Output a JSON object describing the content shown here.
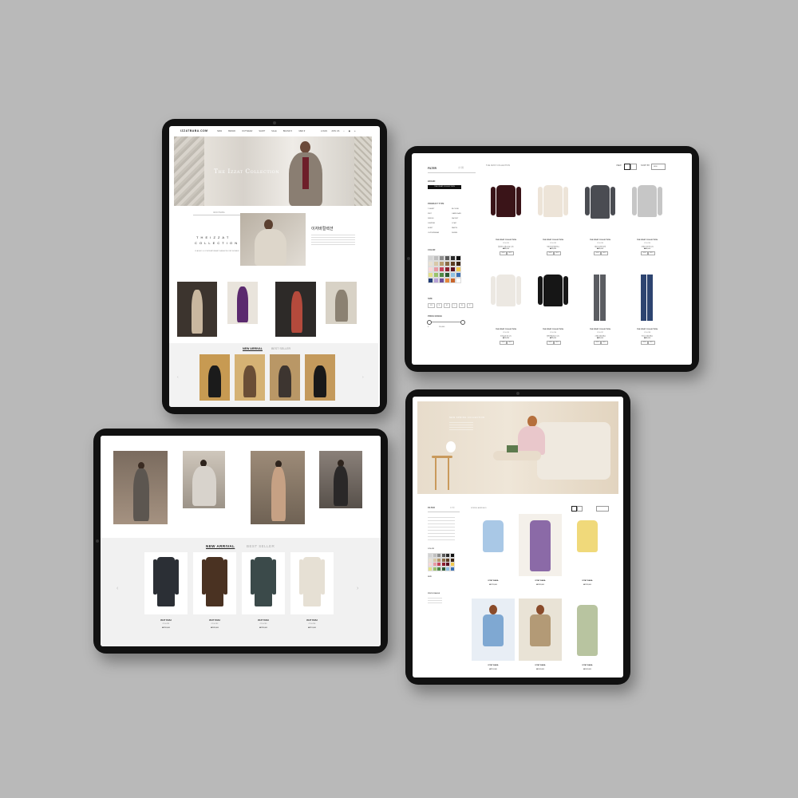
{
  "tablet1": {
    "logo": "IZZATBABA.COM",
    "nav": [
      "NEW",
      "BRAND",
      "OUTWEAR",
      "SHIRT",
      "SALE",
      "BRAND▼",
      "MEN▼"
    ],
    "util": [
      "LOGIN",
      "JOIN US"
    ],
    "hero_title": "The Izzat Collection",
    "section_label": "IZZAT BABA",
    "collection_title": "T H E   I Z Z A T",
    "collection_sub": "C O L L E C T I O N",
    "collection_desc": "CLASSIC & CONTEMPORARY FASHION FOR WOMEN",
    "korean_title": "이자바컬렉션",
    "tab_new": "NEW ARRIVAL",
    "tab_best": "BEST SELLER"
  },
  "tablet2": {
    "filter_label": "FILTER",
    "reset_label": "초기화",
    "breadcrumb": "THE IZZAT COLLECTION",
    "brand_label": "BRAND",
    "brand_selected": "THE IZZAT COLLECTION",
    "product_type_label": "PRODUCT TYPE",
    "product_types": [
      "T-SHIRT",
      "BLOUSE",
      "KNIT",
      "CARDIGAN",
      "DRESS",
      "JACKET",
      "JUMPER",
      "COAT",
      "SKIRT",
      "PANTS",
      "OUTERWEAR",
      "DENIM"
    ],
    "color_label": "COLOR",
    "size_label": "SIZE",
    "sizes": [
      "XS",
      "S",
      "M",
      "L",
      "XL",
      "F"
    ],
    "price_label": "PRICE RANGE",
    "price_min": "0",
    "price_max": "200,000",
    "view_label": "VIEW",
    "sort_label": "SORT BY",
    "sort_value": "NEW",
    "products": [
      {
        "brand": "THE IZZAT COLLECTION",
        "code": "C13-C81",
        "name": "블라우스 에스트로 니트",
        "price": "₩89,000"
      },
      {
        "brand": "THE IZZAT COLLECTION",
        "code": "C13-C82",
        "name": "크림 타이 블라우스",
        "price": "₩79,000"
      },
      {
        "brand": "THE IZZAT COLLECTION",
        "code": "C13-C83",
        "name": "데님 트러커 자켓",
        "price": "₩99,000"
      },
      {
        "brand": "THE IZZAT COLLECTION",
        "code": "C13-C84",
        "name": "그레이 크루넥 니트",
        "price": "₩69,000"
      },
      {
        "brand": "THE IZZAT COLLECTION",
        "code": "C13-C85",
        "name": "아이보리 울 니트",
        "price": "₩79,000"
      },
      {
        "brand": "THE IZZAT COLLECTION",
        "code": "C13-C86",
        "name": "블랙 벨슬리브 니트",
        "price": "₩79,000"
      },
      {
        "brand": "THE IZZAT COLLECTION",
        "code": "C13-C87",
        "name": "그레이 데님 팬츠",
        "price": "₩89,000"
      },
      {
        "brand": "THE IZZAT COLLECTION",
        "code": "C13-C88",
        "name": "인디고 데님 팬츠",
        "price": "₩89,000"
      }
    ],
    "badges": [
      "NEW",
      "BEST"
    ]
  },
  "tablet3": {
    "tab_new": "NEW ARRIVAL",
    "tab_best": "BEST SELLER",
    "products": [
      {
        "brand": "IZZAT BABA",
        "code": "C13-C91",
        "price": "₩259,000"
      },
      {
        "brand": "IZZAT BABA",
        "code": "C13-C92",
        "price": "₩189,000"
      },
      {
        "brand": "IZZAT BABA",
        "code": "C13-C93",
        "price": "₩239,000"
      },
      {
        "brand": "IZZAT BABA",
        "code": "C13-C94",
        "price": "₩219,000"
      }
    ]
  },
  "tablet4": {
    "hero_copy": "NEW SPRING COLLECTION",
    "filter_label": "FILTER",
    "reset_label": "초기화",
    "breadcrumb": "SPRING ARRIVALS",
    "color_label": "COLOR",
    "size_label": "SIZE",
    "price_label": "PRICE RANGE",
    "products": [
      {
        "brand": "IZZAT BABA",
        "price": "₩129,000"
      },
      {
        "brand": "IZZAT BABA",
        "price": "₩189,000"
      },
      {
        "brand": "IZZAT BABA",
        "price": "₩139,000"
      },
      {
        "brand": "IZZAT BABA",
        "price": "₩119,000"
      },
      {
        "brand": "IZZAT BABA",
        "price": "₩109,000"
      },
      {
        "brand": "IZZAT BABA",
        "price": "₩169,000"
      }
    ]
  },
  "colors": {
    "background": "#b9b9b9",
    "bezel": "#111111",
    "accent": "#222222"
  }
}
